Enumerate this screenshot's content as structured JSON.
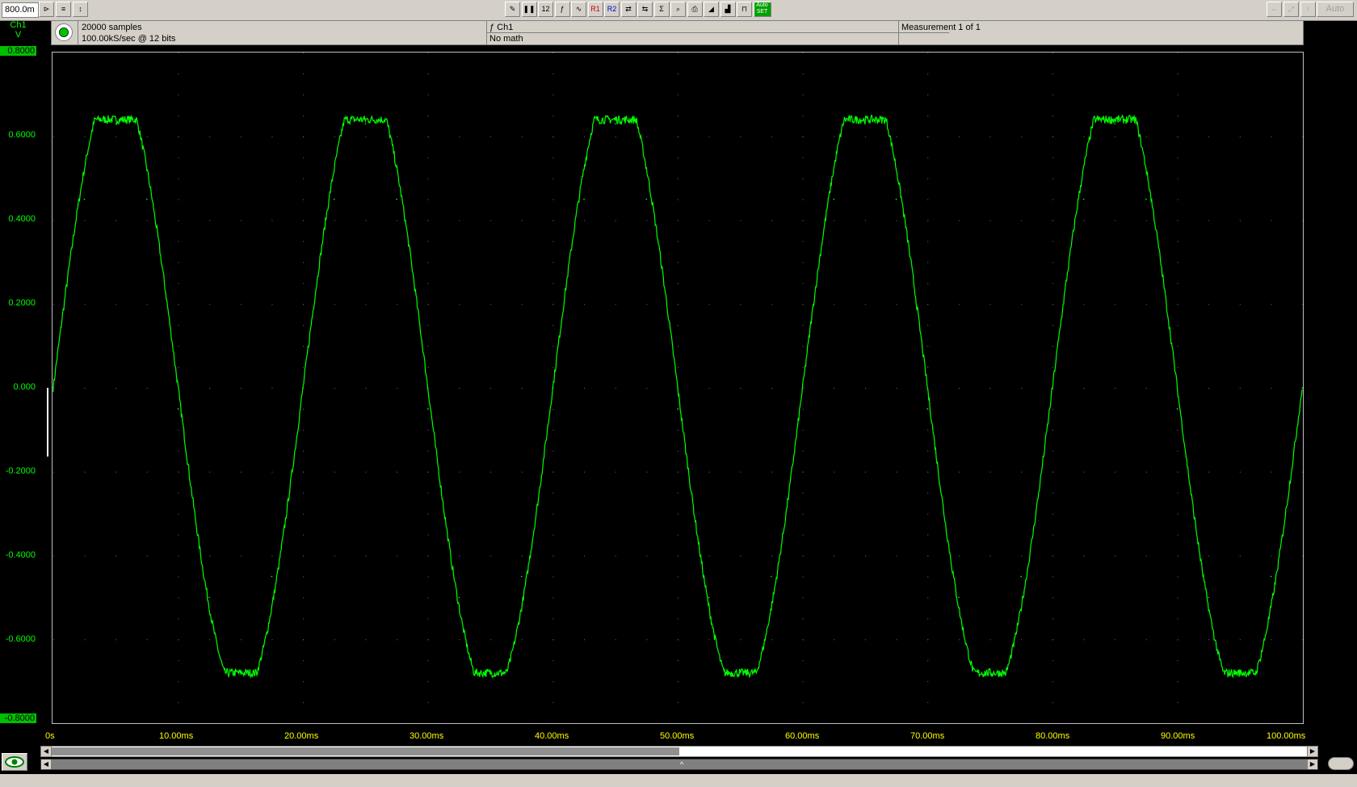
{
  "toolbar": {
    "timebase": "800.0m",
    "buttons": [
      {
        "name": "trigger-button",
        "glyph": "⊳"
      },
      {
        "name": "channels-button",
        "glyph": "≡"
      },
      {
        "name": "cursor-button",
        "glyph": "↕"
      },
      {
        "name": "probe-button",
        "glyph": "✎"
      },
      {
        "name": "pause-button",
        "glyph": "❚❚"
      },
      {
        "name": "decimal-button",
        "glyph": "12"
      },
      {
        "name": "math-button",
        "glyph": "ƒ"
      },
      {
        "name": "spectrum-button",
        "glyph": "∿"
      },
      {
        "name": "ref1-button",
        "glyph": "R1"
      },
      {
        "name": "ref2-button",
        "glyph": "R2"
      },
      {
        "name": "export-button",
        "glyph": "⇄"
      },
      {
        "name": "import-button",
        "glyph": "⇆"
      },
      {
        "name": "sum-button",
        "glyph": "Σ"
      },
      {
        "name": "zoom-button",
        "glyph": "⌕"
      },
      {
        "name": "print-button",
        "glyph": "⎙"
      },
      {
        "name": "ramp-button",
        "glyph": "◢"
      },
      {
        "name": "step-button",
        "glyph": "▟"
      },
      {
        "name": "filter-button",
        "glyph": "⊓"
      },
      {
        "name": "auto-set-button",
        "glyph": "Auto SET"
      }
    ],
    "right_buttons": [
      {
        "name": "fit-button",
        "glyph": "⇔"
      },
      {
        "name": "expand-button",
        "glyph": "⤢"
      },
      {
        "name": "up-button",
        "glyph": "↑"
      }
    ],
    "auto_label": "Auto"
  },
  "channel": {
    "name": "Ch1",
    "unit": "V"
  },
  "info": {
    "samples": "20000 samples",
    "rate": "100.00kS/sec @ 12 bits",
    "math_channel": "ƒ Ch1",
    "math": "No math",
    "measurement": "Measurement 1 of 1"
  },
  "colors": {
    "trace": "#00ff00",
    "axis_x": "#ffff00",
    "bg": "#000000"
  },
  "chart_data": {
    "type": "line",
    "title": "",
    "xlabel": "",
    "ylabel": "V",
    "xlim": [
      0,
      100
    ],
    "ylim": [
      -0.8,
      0.8
    ],
    "x_unit": "ms",
    "y_ticks": [
      "0.8000",
      "0.6000",
      "0.4000",
      "0.2000",
      "0.000",
      "-0.2000",
      "-0.4000",
      "-0.6000",
      "-0.8000"
    ],
    "x_ticks": [
      "0s",
      "10.00ms",
      "20.00ms",
      "30.00ms",
      "40.00ms",
      "50.00ms",
      "60.00ms",
      "70.00ms",
      "80.00ms",
      "90.00ms",
      "100.00ms"
    ],
    "grid": true,
    "series": [
      {
        "frequency_hz": 50,
        "amplitude": 0.65,
        "x": [
          0,
          2.5,
          5,
          7.5,
          10,
          12.5,
          15,
          17.5,
          20,
          22.5,
          25,
          27.5,
          30,
          32.5,
          35,
          37.5,
          40,
          42.5,
          45,
          47.5,
          50,
          52.5,
          55,
          57.5,
          60,
          62.5,
          65,
          67.5,
          70,
          72.5,
          75,
          77.5,
          80,
          82.5,
          85,
          87.5,
          90,
          92.5,
          95,
          97.5,
          100
        ],
        "y": [
          0.0,
          0.45,
          0.63,
          0.45,
          -0.05,
          -0.5,
          -0.68,
          -0.45,
          0.0,
          0.45,
          0.63,
          0.45,
          -0.05,
          -0.5,
          -0.68,
          -0.45,
          0.0,
          0.45,
          0.63,
          0.45,
          -0.05,
          -0.5,
          -0.68,
          -0.45,
          0.0,
          0.45,
          0.63,
          0.45,
          -0.05,
          -0.5,
          -0.68,
          -0.45,
          0.0,
          0.45,
          0.63,
          0.45,
          -0.05,
          -0.5,
          -0.68,
          -0.45,
          0.0
        ]
      }
    ]
  }
}
